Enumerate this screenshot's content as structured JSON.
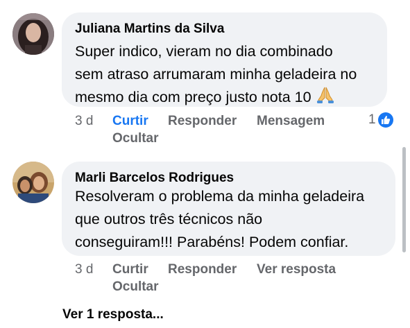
{
  "comments": [
    {
      "author": "Juliana Martins da Silva",
      "text_lines": [
        "Super indico, vieram no dia combinado",
        "sem atraso arrumaram minha geladeira no",
        "mesmo dia com preço justo nota 10"
      ],
      "emoji": "praying-hands",
      "time": "3 d",
      "actions": [
        "Curtir",
        "Responder",
        "Mensagem",
        "Ocultar"
      ],
      "liked": true,
      "reaction_count": "1"
    },
    {
      "author": "Marli Barcelos Rodrigues",
      "text_lines": [
        "Resolveram o problema da minha geladeira",
        "que outros três técnicos não",
        "conseguiram!!! Parabéns! Podem confiar."
      ],
      "time": "3 d",
      "actions": [
        "Curtir",
        "Responder",
        "Ver resposta",
        "Ocultar"
      ],
      "liked": false
    }
  ],
  "more_replies": "Ver 1 resposta...",
  "colors": {
    "bubble": "#f0f2f5",
    "meta": "#65676b",
    "accent": "#1877f2",
    "text": "#050505"
  }
}
